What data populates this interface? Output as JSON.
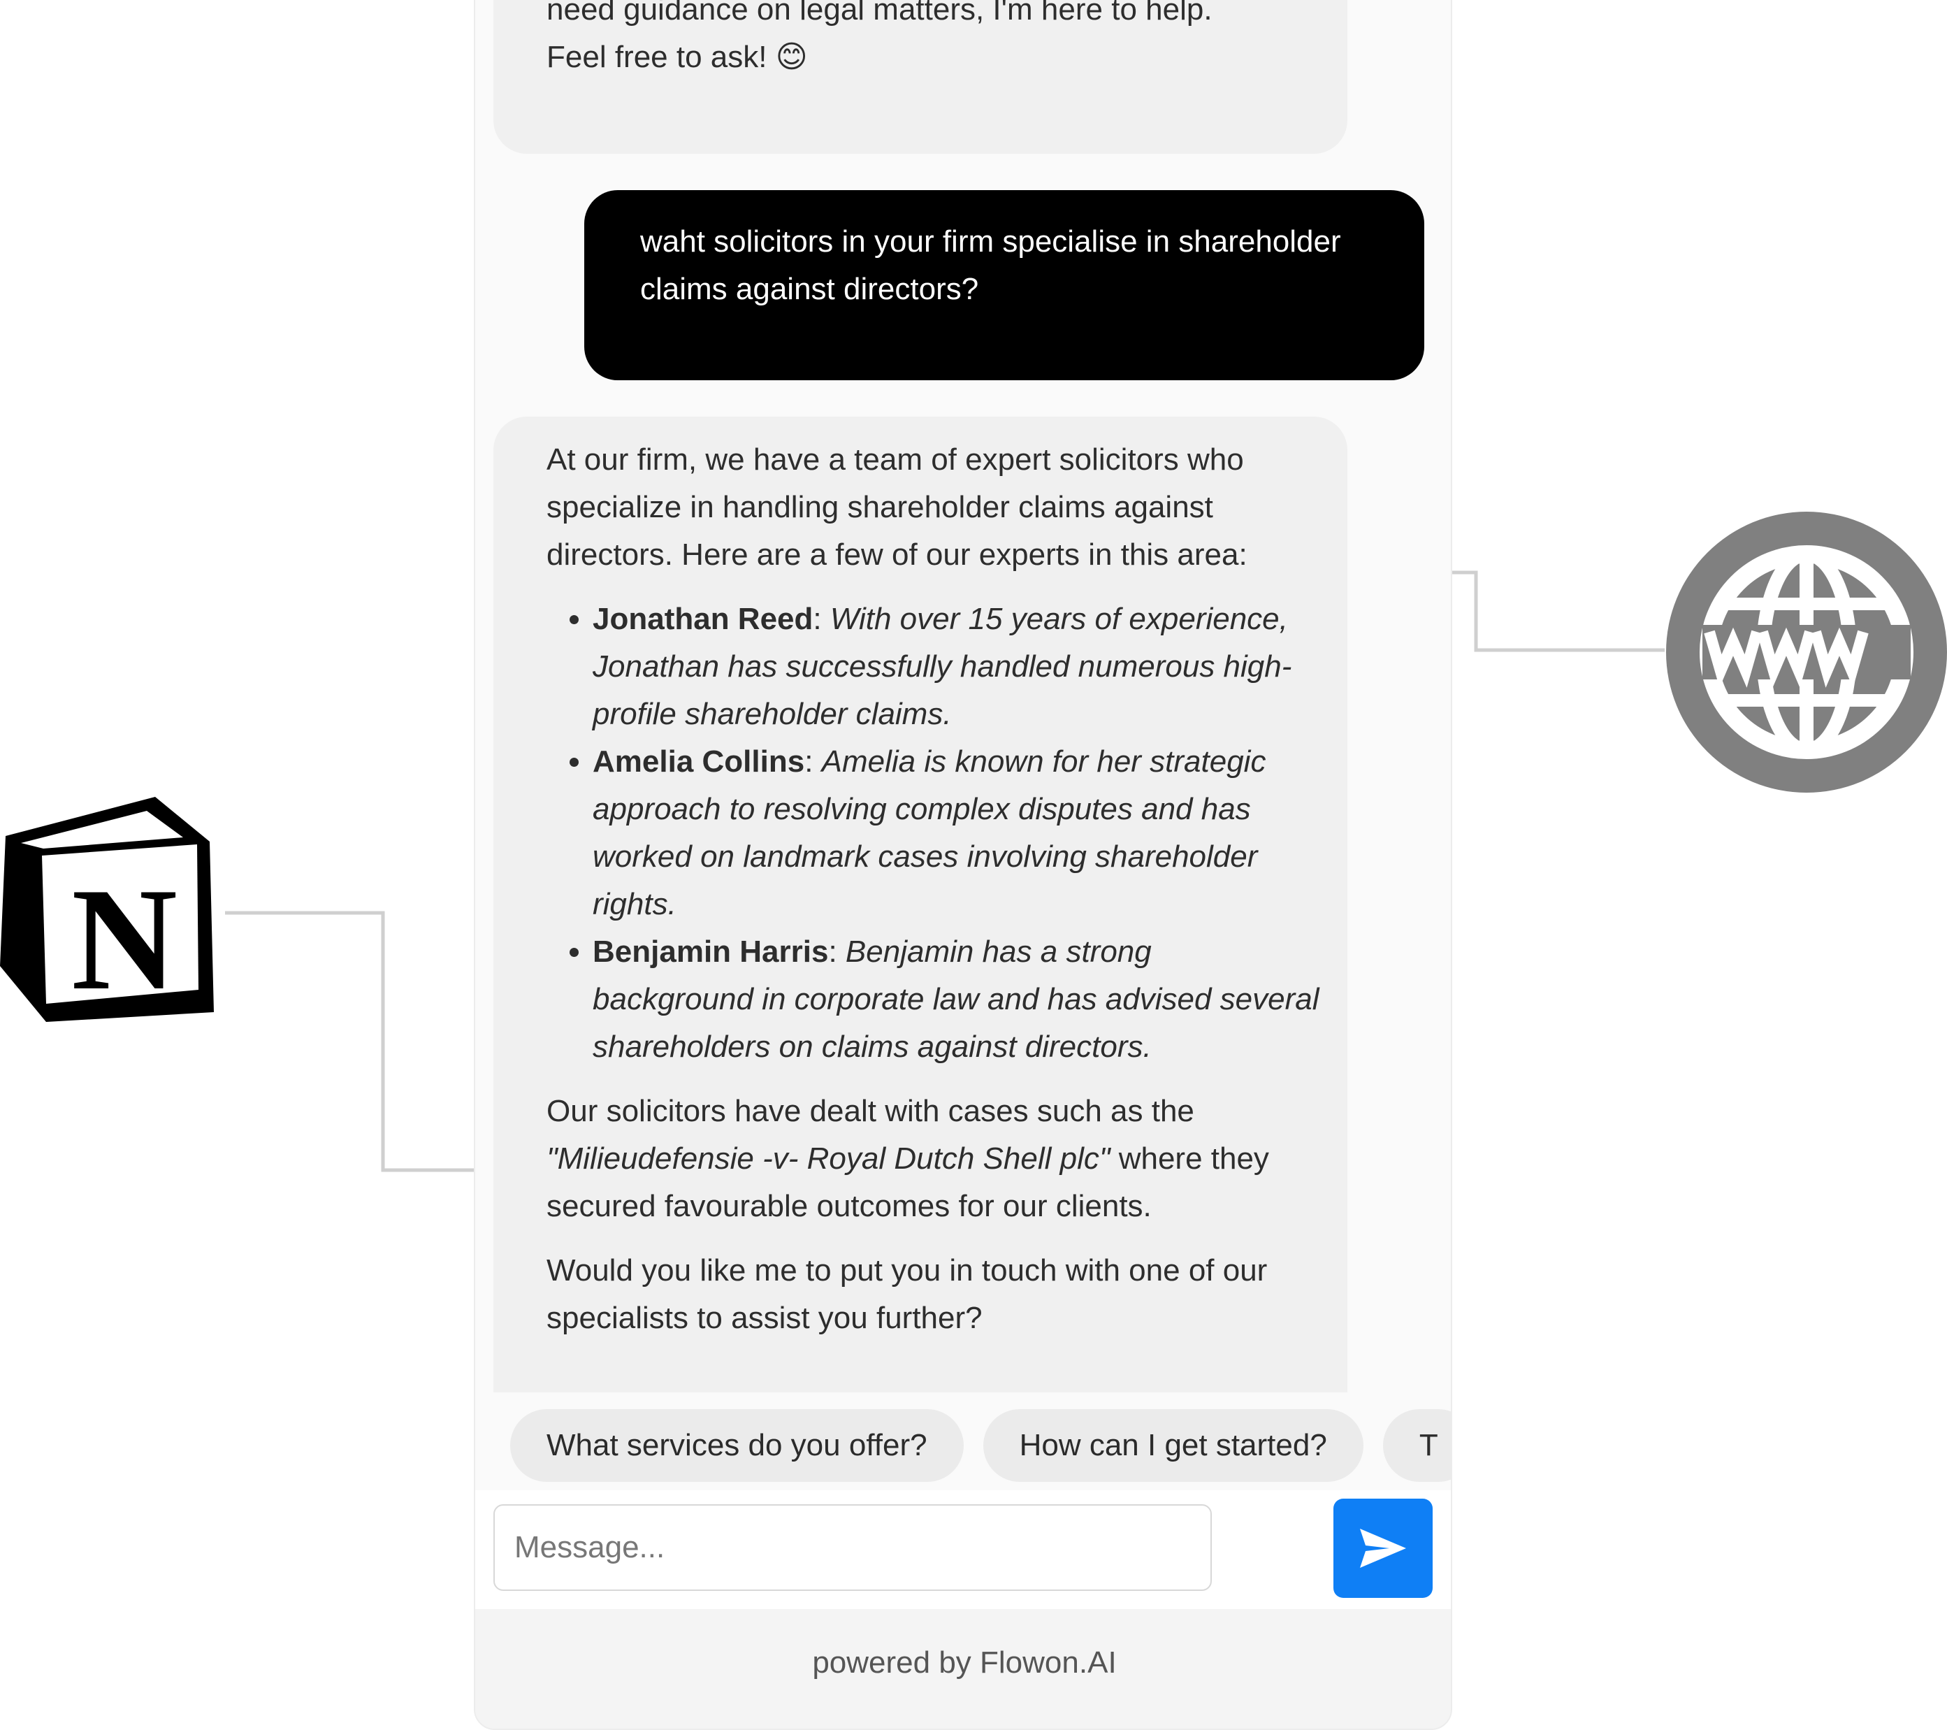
{
  "messages": {
    "intro_bot": {
      "line1": "need guidance on legal matters, I'm here to help.",
      "line2": "Feel free to ask! 😊"
    },
    "user_question": "waht solicitors in your firm specialise in shareholder claims against directors?",
    "answer": {
      "intro": "At our firm, we have a team of expert solicitors who specialize in handling shareholder claims against directors. Here are a few of our experts in this area:",
      "experts": [
        {
          "name": "Jonathan Reed",
          "sep": ": ",
          "description": "With over 15 years of experience, Jonathan has successfully handled numerous high-profile shareholder claims."
        },
        {
          "name": "Amelia Collins",
          "sep": ": ",
          "description": "Amelia is known for her strategic approach to resolving complex disputes and has worked on landmark cases involving shareholder rights."
        },
        {
          "name": "Benjamin Harris",
          "sep": ": ",
          "description": "Benjamin has a strong background in corporate law and has advised several shareholders on claims against directors."
        }
      ],
      "cases_before": "Our solicitors have dealt with cases such as the ",
      "case_name": "\"Milieudefensie -v- Royal Dutch Shell plc\"",
      "cases_after": " where they secured favourable outcomes for our clients.",
      "closing": "Would you like me to put you in touch with one of our specialists to assist you further?"
    }
  },
  "suggestions": [
    "What services do you offer?",
    "How can I get started?",
    "T"
  ],
  "composer": {
    "placeholder": "Message...",
    "send_icon": "send-icon"
  },
  "footer": {
    "powered_by": "powered by Flowon.AI"
  },
  "sources": {
    "notion_logo_letter": "N",
    "notion_icon": "notion-icon",
    "web_icon": "www-globe-icon"
  },
  "colors": {
    "accent": "#0f7ff5",
    "user_bubble": "#000000",
    "bot_bubble": "#f0f0f0",
    "globe_gray": "#808080"
  }
}
